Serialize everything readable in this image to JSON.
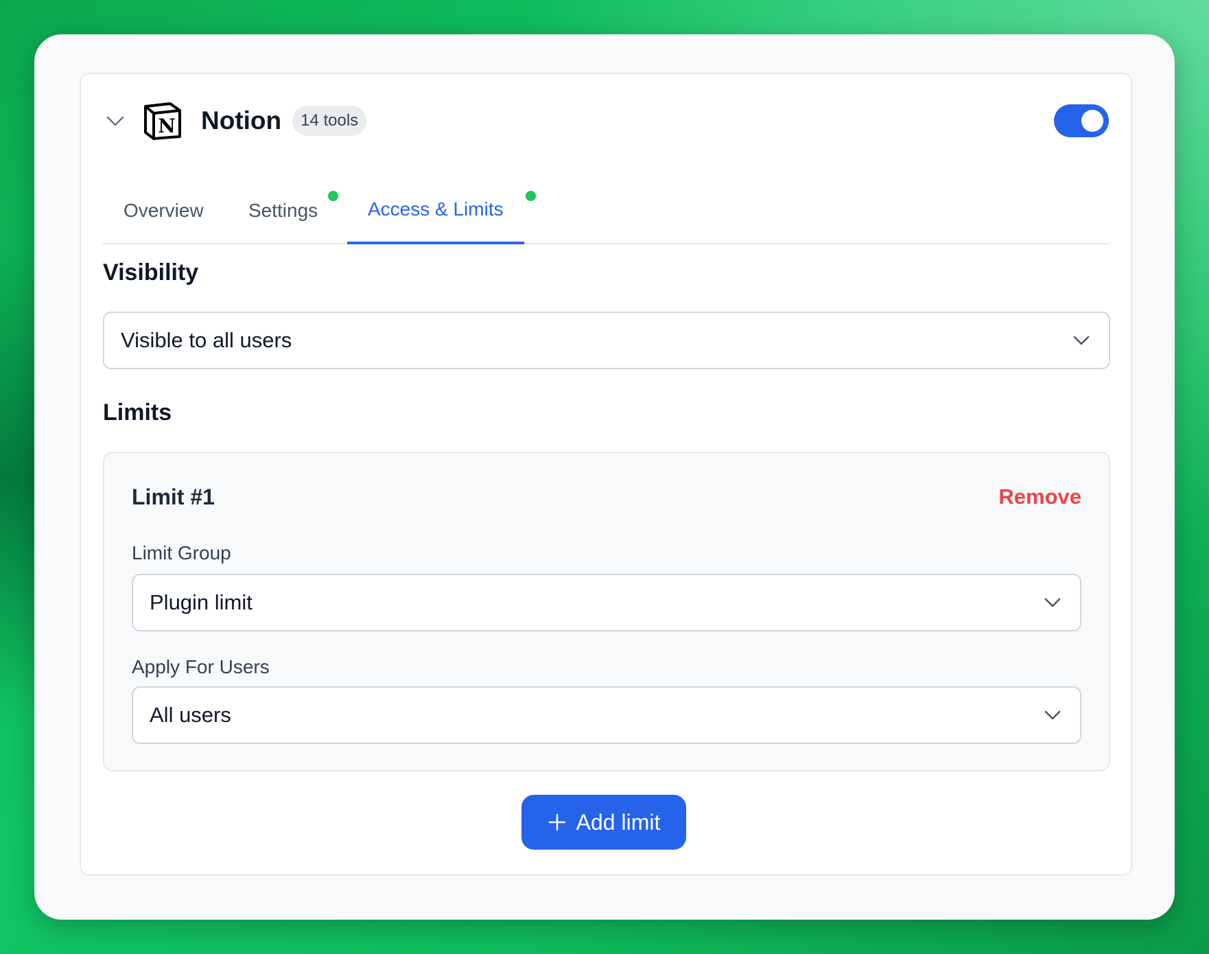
{
  "plugin": {
    "name": "Notion",
    "tools_badge": "14 tools",
    "enabled": true,
    "logo_letter": "N"
  },
  "tabs": [
    {
      "label": "Overview",
      "active": false,
      "dot": false
    },
    {
      "label": "Settings",
      "active": false,
      "dot": true
    },
    {
      "label": "Access & Limits",
      "active": true,
      "dot": true
    }
  ],
  "visibility": {
    "title": "Visibility",
    "selected": "Visible to all users"
  },
  "limits": {
    "title": "Limits",
    "items": [
      {
        "title": "Limit #1",
        "remove_label": "Remove",
        "group_label": "Limit Group",
        "group_value": "Plugin limit",
        "apply_label": "Apply For Users",
        "apply_value": "All users"
      }
    ],
    "add_label": "Add limit"
  },
  "colors": {
    "accent": "#2563eb",
    "danger": "#ef4444",
    "dot": "#22c55e",
    "background": "#10b95c"
  }
}
